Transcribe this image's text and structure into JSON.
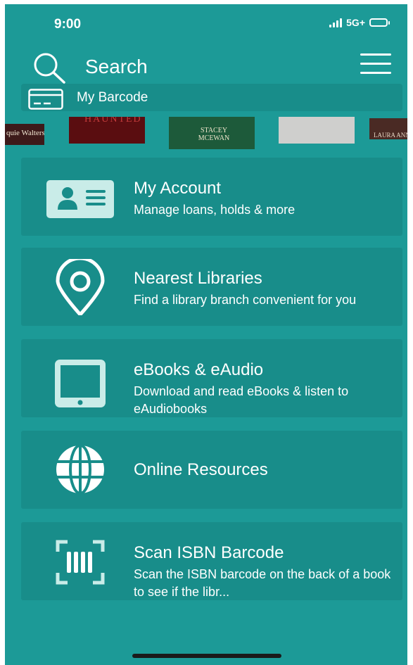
{
  "status_bar": {
    "time": "9:00",
    "network": "5G+"
  },
  "header": {
    "search_label": "Search"
  },
  "barcode": {
    "label": "My Barcode"
  },
  "carousel": {
    "covers": [
      {
        "text": "quie Walters"
      },
      {
        "text": "HAUNTED"
      },
      {
        "text": "STACEY MCEWAN"
      },
      {
        "text": ""
      },
      {
        "text": "LAURA ANNE"
      }
    ]
  },
  "cards": [
    {
      "title": "My Account",
      "desc": "Manage loans, holds & more",
      "icon": "id-card-icon"
    },
    {
      "title": "Nearest Libraries",
      "desc": "Find a library branch convenient for you",
      "icon": "location-pin-icon"
    },
    {
      "title": "eBooks & eAudio",
      "desc": "Download and read eBooks & listen to eAudiobooks",
      "icon": "tablet-icon"
    },
    {
      "title": "Online Resources",
      "desc": "",
      "icon": "globe-icon"
    },
    {
      "title": "Scan ISBN Barcode",
      "desc": "Scan the ISBN barcode on the back of a book to see if the libr...",
      "icon": "barcode-scan-icon"
    }
  ],
  "colors": {
    "background": "#1c9a97",
    "card": "#188d8a",
    "icon_light": "#c9ece8",
    "text": "#ffffff"
  }
}
